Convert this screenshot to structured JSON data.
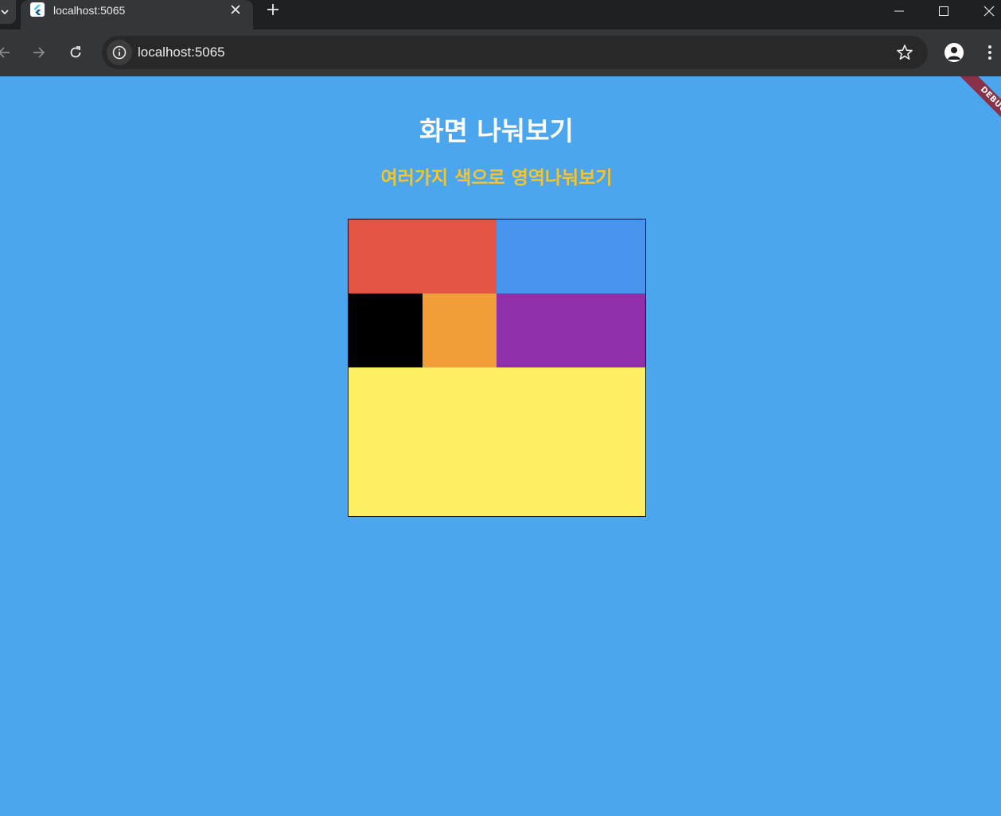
{
  "browser": {
    "tab_title": "localhost:5065",
    "url": "localhost:5065",
    "icons": {
      "tab_list": "chevron-down-icon",
      "close": "close-icon",
      "new_tab": "plus-icon",
      "back": "arrow-left-icon",
      "forward": "arrow-right-icon",
      "reload": "reload-icon",
      "site_info": "info-icon",
      "bookmark": "star-icon",
      "profile": "account-icon",
      "menu": "more-vert-icon"
    }
  },
  "page": {
    "title": "화면 나눠보기",
    "subtitle": "여러가지 색으로 영역나눠보기",
    "debug_label": "DEBUG",
    "background_color": "#4ba6ed",
    "title_color": "#ffffff",
    "subtitle_color": "#f7c52b"
  },
  "color_regions": [
    {
      "name": "red",
      "color": "#e25543"
    },
    {
      "name": "blue",
      "color": "#4994ec"
    },
    {
      "name": "black",
      "color": "#000000"
    },
    {
      "name": "orange",
      "color": "#f29e38"
    },
    {
      "name": "purple",
      "color": "#8f30aa"
    },
    {
      "name": "yellow",
      "color": "#fdee63"
    }
  ]
}
